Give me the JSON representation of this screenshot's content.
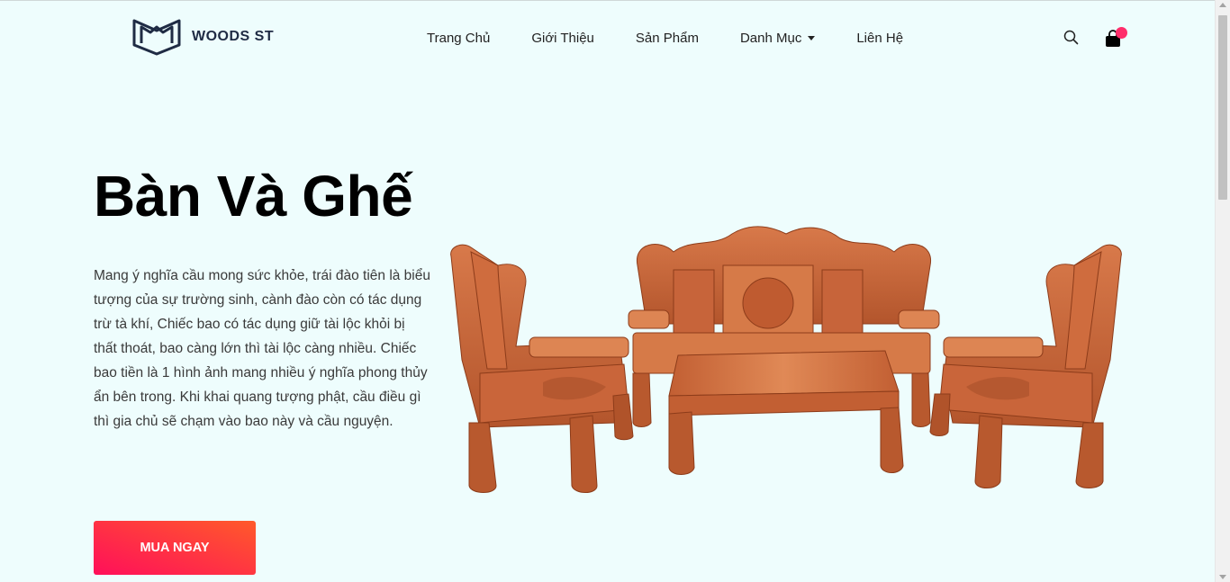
{
  "brand": {
    "name": "WOODS ST"
  },
  "nav": {
    "items": [
      "Trang Chủ",
      "Giới Thiệu",
      "Sản Phẩm",
      "Danh Mục",
      "Liên Hệ"
    ]
  },
  "icons": {
    "search": "search-icon",
    "cart": "shopping-bag-icon",
    "dropdown": "caret-down-icon"
  },
  "hero": {
    "title": "Bàn Và Ghế",
    "description": "Mang ý nghĩa cầu mong sức khỏe, trái đào tiên là biểu tượng của sự trường sinh, cành đào còn có tác dụng trừ tà khí, Chiếc bao có tác dụng giữ tài lộc khỏi bị thất thoát, bao càng lớn thì tài lộc càng nhiều. Chiếc bao tiền là 1 hình ảnh mang nhiều ý nghĩa phong thủy ẩn bên trong. Khi khai quang tượng phật, cầu điều gì thì gia chủ sẽ chạm vào bao này và cầu nguyện.",
    "cta": "MUA NGAY"
  },
  "colors": {
    "background": "#eefdfd",
    "accent_start": "#ff0f5a",
    "accent_end": "#ff5a2a",
    "badge": "#ff2d6b",
    "wood": "#c8643a"
  }
}
